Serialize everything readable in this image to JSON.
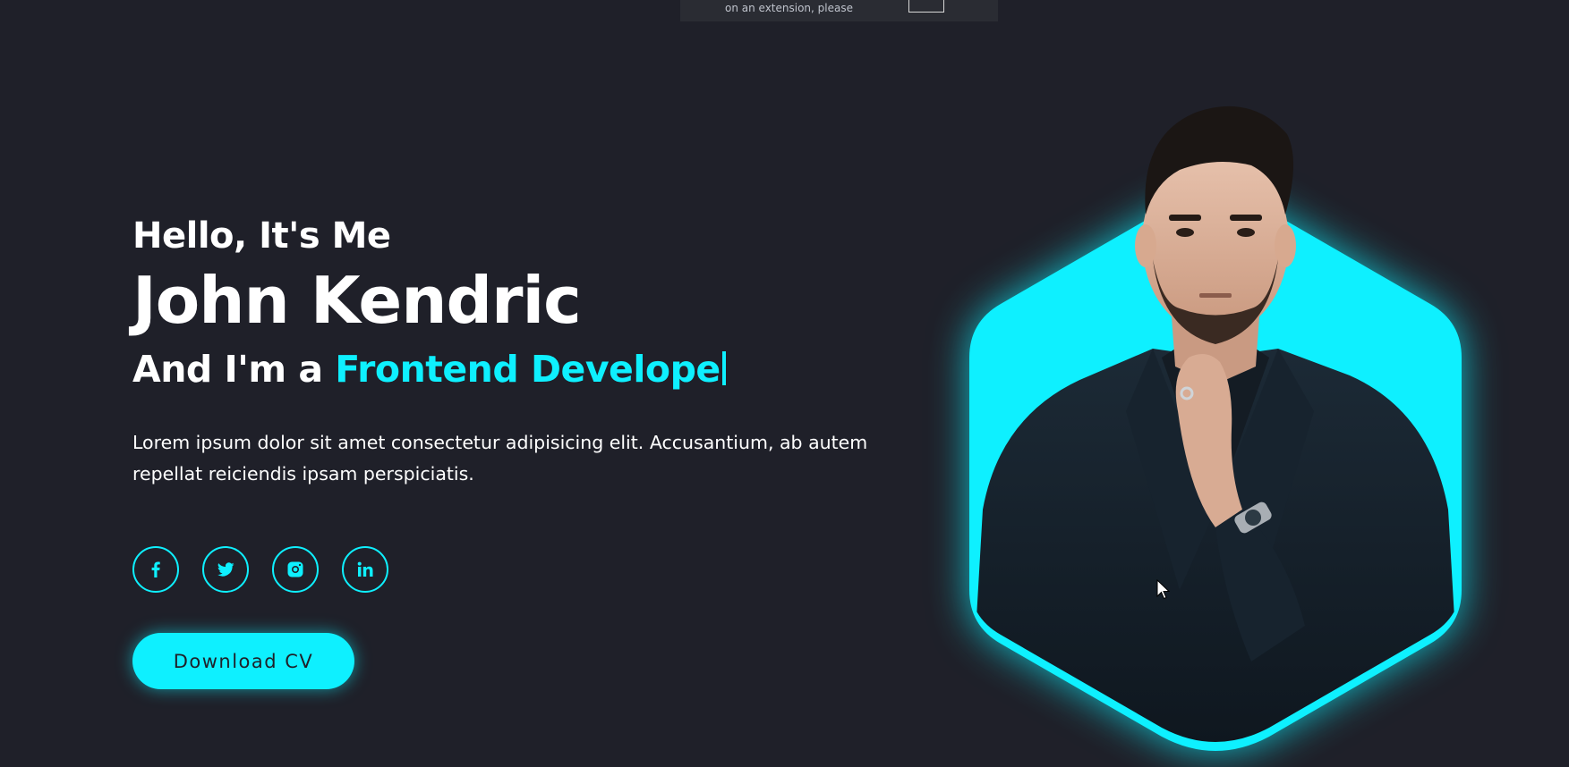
{
  "topbar": {
    "text": "on an extension, please"
  },
  "hero": {
    "greeting": "Hello, It's Me",
    "name": "John Kendric",
    "role_prefix": "And I'm a ",
    "role_accent": "Frontend Develope",
    "description": "Lorem ipsum dolor sit amet consectetur adipisicing elit. Accusantium, ab autem repellat reiciendis ipsam perspiciatis."
  },
  "socials": [
    {
      "icon": "facebook-icon"
    },
    {
      "icon": "twitter-icon"
    },
    {
      "icon": "instagram-icon"
    },
    {
      "icon": "linkedin-icon"
    }
  ],
  "cta": {
    "label": "Download CV"
  },
  "colors": {
    "background": "#1f2029",
    "accent": "#0ef0ff",
    "text": "#ffffff"
  }
}
